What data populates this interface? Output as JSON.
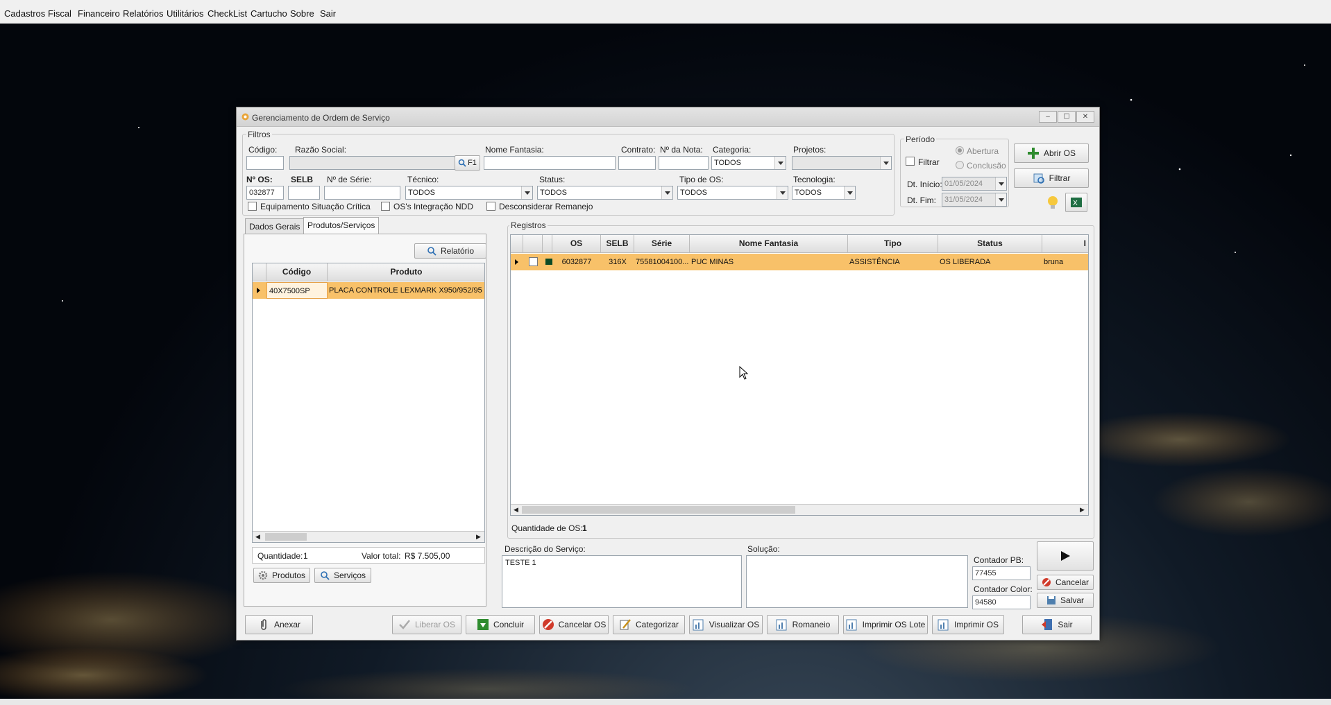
{
  "menu": [
    "Cadastros",
    "Fiscal",
    "Financeiro",
    "Relatórios",
    "Utilitários",
    "CheckList",
    "Cartucho",
    "Sobre",
    "Sair"
  ],
  "window": {
    "title": "Gerenciamento de Ordem de Serviço",
    "controls": {
      "minimize": "–",
      "maximize": "☐",
      "close": "✕"
    }
  },
  "filters": {
    "group_label": "Filtros",
    "codigo_label": "Código:",
    "razao_label": "Razão Social:",
    "razao_button": "F1",
    "fantasia_label": "Nome Fantasia:",
    "contrato_label": "Contrato:",
    "nota_label": "Nº da Nota:",
    "categoria_label": "Categoria:",
    "categoria_value": "TODOS",
    "projetos_label": "Projetos:",
    "nos_label": "Nº OS:",
    "nos_value": "032877",
    "selb_label": "SELB",
    "serie_label": "Nº de Série:",
    "tecnico_label": "Técnico:",
    "tecnico_value": "TODOS",
    "status_label": "Status:",
    "status_value": "TODOS",
    "tipo_label": "Tipo de OS:",
    "tipo_value": "TODOS",
    "tecnologia_label": "Tecnologia:",
    "tecnologia_value": "TODOS",
    "chk_equip": "Equipamento Situação Crítica",
    "chk_ndd": "OS's Integração NDD",
    "chk_remanejo": "Desconsiderar Remanejo"
  },
  "periodo": {
    "group_label": "Período",
    "filtrar": "Filtrar",
    "abertura": "Abertura",
    "conclusao": "Conclusão",
    "inicio_label": "Dt. Início:",
    "inicio_value": "01/05/2024",
    "fim_label": "Dt. Fim:",
    "fim_value": "31/05/2024"
  },
  "actions": {
    "abrir_os": "Abrir OS",
    "filtrar": "Filtrar"
  },
  "left_panel": {
    "tabs": [
      "Dados Gerais",
      "Produtos/Serviços"
    ],
    "relatorio": "Relatório",
    "columns": [
      "Código",
      "Produto"
    ],
    "rows": [
      {
        "codigo": "40X7500SP",
        "produto": "PLACA CONTROLE LEXMARK X950/952/95"
      }
    ],
    "quantidade_label": "Quantidade:",
    "quantidade_value": "1",
    "valor_label": "Valor total:",
    "valor_value": "R$ 7.505,00",
    "produtos_btn": "Produtos",
    "servicos_btn": "Serviços"
  },
  "registros": {
    "group_label": "Registros",
    "columns": [
      "OS",
      "SELB",
      "Série",
      "Nome Fantasia",
      "Tipo",
      "Status",
      "I"
    ],
    "rows": [
      {
        "os": "6032877",
        "selb": "316X",
        "serie": "75581004100...",
        "fantasia": "PUC MINAS",
        "tipo": "ASSISTÊNCIA",
        "status": "OS LIBERADA",
        "user": "bruna"
      }
    ],
    "quantidade_label": "Quantidade de OS:",
    "quantidade_value": "1"
  },
  "descricao": {
    "label": "Descrição do Serviço:",
    "value": "TESTE 1"
  },
  "solucao": {
    "label": "Solução:",
    "value": ""
  },
  "contador": {
    "pb_label": "Contador PB:",
    "pb_value": "77455",
    "color_label": "Contador Color:",
    "color_value": "94580"
  },
  "side_buttons": {
    "cancelar": "Cancelar",
    "salvar": "Salvar"
  },
  "bottom_buttons": {
    "anexar": "Anexar",
    "liberar": "Liberar OS",
    "concluir": "Concluir",
    "cancelar_os": "Cancelar OS",
    "categorizar": "Categorizar",
    "visualizar": "Visualizar OS",
    "romaneio": "Romaneio",
    "imprimir_lote": "Imprimir OS Lote",
    "imprimir": "Imprimir OS",
    "sair": "Sair"
  },
  "colors": {
    "selected_row": "#f8c169",
    "accent_green": "#2e8b2e",
    "cancel_red": "#d03a2a"
  }
}
